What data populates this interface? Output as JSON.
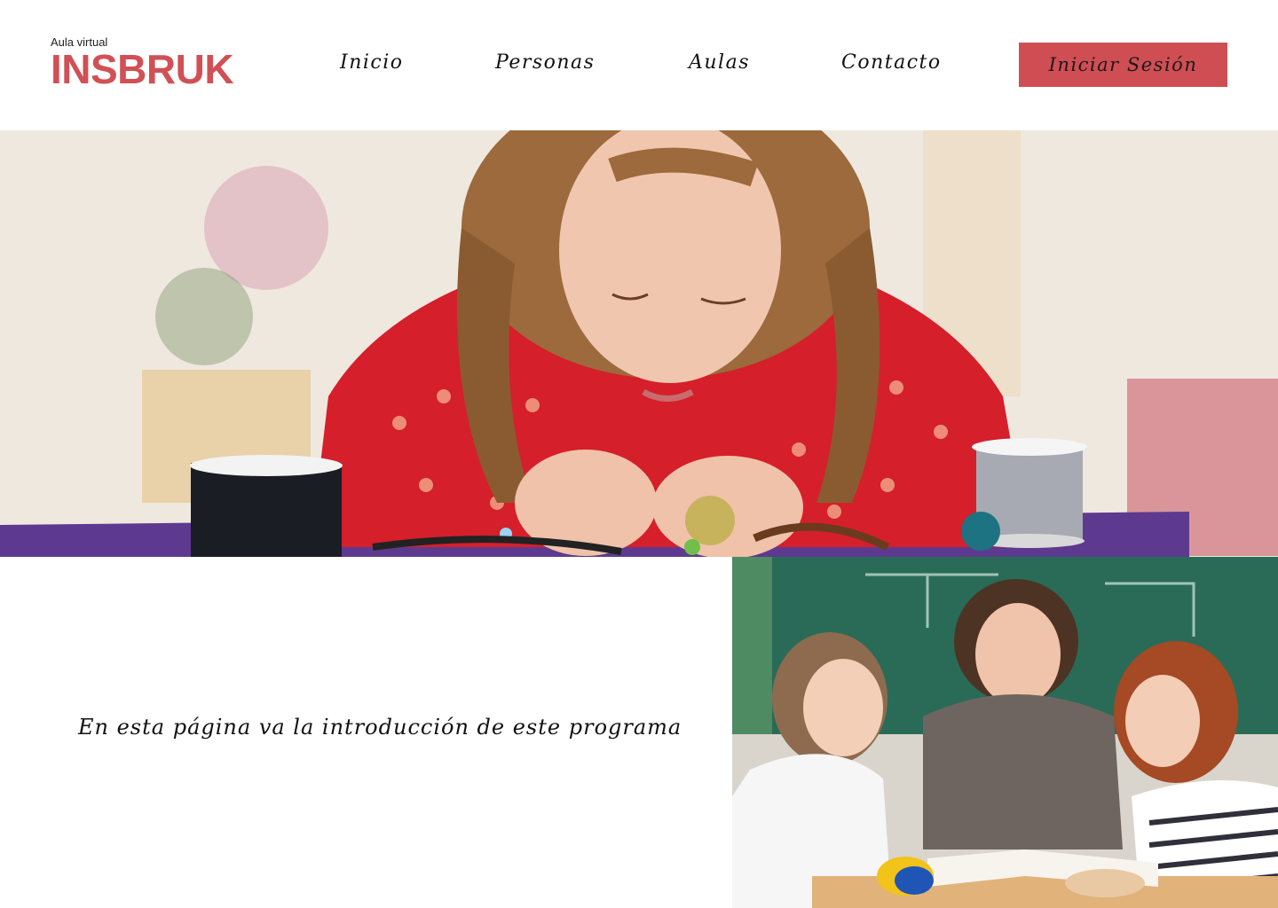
{
  "header": {
    "logo_subtitle": "Aula virtual",
    "logo_title": "INSBRUK",
    "nav": [
      "Inicio",
      "Personas",
      "Aulas",
      "Contacto"
    ],
    "login_label": "Iniciar Sesión"
  },
  "intro": {
    "text": "En esta página va la introducción de este programa"
  },
  "images": {
    "hero": "girl-threading-beads-photo",
    "classroom": "teacher-with-two-girls-photo"
  },
  "colors": {
    "brand": "#d05155",
    "button": "#cf4e54",
    "text": "#111111"
  }
}
